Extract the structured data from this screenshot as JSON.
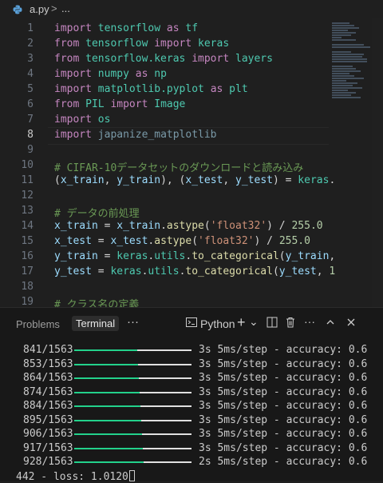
{
  "breadcrumb": {
    "file": "a.py",
    "separator": ">",
    "more": "..."
  },
  "editor": {
    "lines": [
      {
        "n": "1",
        "tokens": [
          {
            "t": "import ",
            "c": "kw"
          },
          {
            "t": "tensorflow ",
            "c": "cls"
          },
          {
            "t": "as ",
            "c": "kw"
          },
          {
            "t": "tf",
            "c": "cls"
          }
        ]
      },
      {
        "n": "2",
        "tokens": [
          {
            "t": "from ",
            "c": "kw"
          },
          {
            "t": "tensorflow ",
            "c": "cls"
          },
          {
            "t": "import ",
            "c": "kw"
          },
          {
            "t": "keras",
            "c": "cls"
          }
        ]
      },
      {
        "n": "3",
        "tokens": [
          {
            "t": "from ",
            "c": "kw"
          },
          {
            "t": "tensorflow.keras ",
            "c": "cls"
          },
          {
            "t": "import ",
            "c": "kw"
          },
          {
            "t": "layers",
            "c": "cls"
          }
        ]
      },
      {
        "n": "4",
        "tokens": [
          {
            "t": "import ",
            "c": "kw"
          },
          {
            "t": "numpy ",
            "c": "cls"
          },
          {
            "t": "as ",
            "c": "kw"
          },
          {
            "t": "np",
            "c": "cls"
          }
        ]
      },
      {
        "n": "5",
        "tokens": [
          {
            "t": "import ",
            "c": "kw"
          },
          {
            "t": "matplotlib.pyplot ",
            "c": "cls"
          },
          {
            "t": "as ",
            "c": "kw"
          },
          {
            "t": "plt",
            "c": "cls"
          }
        ]
      },
      {
        "n": "6",
        "tokens": [
          {
            "t": "from ",
            "c": "kw"
          },
          {
            "t": "PIL ",
            "c": "cls"
          },
          {
            "t": "import ",
            "c": "kw"
          },
          {
            "t": "Image",
            "c": "cls"
          }
        ]
      },
      {
        "n": "7",
        "tokens": [
          {
            "t": "import ",
            "c": "kw"
          },
          {
            "t": "os",
            "c": "cls"
          }
        ]
      },
      {
        "n": "8",
        "active": true,
        "tokens": [
          {
            "t": "import ",
            "c": "kw"
          },
          {
            "t": "japanize_matplotlib",
            "c": "dim"
          }
        ]
      },
      {
        "n": "9",
        "tokens": []
      },
      {
        "n": "10",
        "tokens": [
          {
            "t": "# CIFAR-10データセットのダウンロードと読み込み",
            "c": "cmt"
          }
        ]
      },
      {
        "n": "11",
        "tokens": [
          {
            "t": "(",
            "c": "plain"
          },
          {
            "t": "x_train",
            "c": "id"
          },
          {
            "t": ", ",
            "c": "plain"
          },
          {
            "t": "y_train",
            "c": "id"
          },
          {
            "t": "), (",
            "c": "plain"
          },
          {
            "t": "x_test",
            "c": "id"
          },
          {
            "t": ", ",
            "c": "plain"
          },
          {
            "t": "y_test",
            "c": "id"
          },
          {
            "t": ") = ",
            "c": "plain"
          },
          {
            "t": "keras",
            "c": "cls"
          },
          {
            "t": ".",
            "c": "plain"
          }
        ]
      },
      {
        "n": "12",
        "tokens": []
      },
      {
        "n": "13",
        "tokens": [
          {
            "t": "# データの前処理",
            "c": "cmt"
          }
        ]
      },
      {
        "n": "14",
        "tokens": [
          {
            "t": "x_train",
            "c": "id"
          },
          {
            "t": " = ",
            "c": "plain"
          },
          {
            "t": "x_train",
            "c": "id"
          },
          {
            "t": ".",
            "c": "plain"
          },
          {
            "t": "astype",
            "c": "fn"
          },
          {
            "t": "(",
            "c": "plain"
          },
          {
            "t": "'float32'",
            "c": "str"
          },
          {
            "t": ") / ",
            "c": "plain"
          },
          {
            "t": "255.0",
            "c": "num"
          }
        ]
      },
      {
        "n": "15",
        "tokens": [
          {
            "t": "x_test",
            "c": "id"
          },
          {
            "t": " = ",
            "c": "plain"
          },
          {
            "t": "x_test",
            "c": "id"
          },
          {
            "t": ".",
            "c": "plain"
          },
          {
            "t": "astype",
            "c": "fn"
          },
          {
            "t": "(",
            "c": "plain"
          },
          {
            "t": "'float32'",
            "c": "str"
          },
          {
            "t": ") / ",
            "c": "plain"
          },
          {
            "t": "255.0",
            "c": "num"
          }
        ]
      },
      {
        "n": "16",
        "tokens": [
          {
            "t": "y_train",
            "c": "id"
          },
          {
            "t": " = ",
            "c": "plain"
          },
          {
            "t": "keras",
            "c": "cls"
          },
          {
            "t": ".",
            "c": "plain"
          },
          {
            "t": "utils",
            "c": "cls"
          },
          {
            "t": ".",
            "c": "plain"
          },
          {
            "t": "to_categorical",
            "c": "fn"
          },
          {
            "t": "(",
            "c": "plain"
          },
          {
            "t": "y_train",
            "c": "id"
          },
          {
            "t": ",",
            "c": "plain"
          }
        ]
      },
      {
        "n": "17",
        "tokens": [
          {
            "t": "y_test",
            "c": "id"
          },
          {
            "t": " = ",
            "c": "plain"
          },
          {
            "t": "keras",
            "c": "cls"
          },
          {
            "t": ".",
            "c": "plain"
          },
          {
            "t": "utils",
            "c": "cls"
          },
          {
            "t": ".",
            "c": "plain"
          },
          {
            "t": "to_categorical",
            "c": "fn"
          },
          {
            "t": "(",
            "c": "plain"
          },
          {
            "t": "y_test",
            "c": "id"
          },
          {
            "t": ", ",
            "c": "plain"
          },
          {
            "t": "1",
            "c": "num"
          }
        ]
      },
      {
        "n": "18",
        "tokens": []
      },
      {
        "n": "19",
        "tokens": [
          {
            "t": "# クラス名の定義",
            "c": "cmt"
          }
        ]
      }
    ]
  },
  "panel": {
    "tabs": [
      "Problems",
      "Terminal"
    ],
    "active_tab": "Terminal",
    "more_label": "···",
    "shell_label": "Python",
    "controls": [
      "+",
      "⌄",
      "◫",
      "🗑",
      "···",
      "^",
      "×"
    ]
  },
  "terminal": {
    "accent_color": "#23d18b",
    "progress_lines": [
      {
        "step": "841/1563",
        "progress": 0.538,
        "rest": "3s 5ms/step - accuracy: 0.6"
      },
      {
        "step": "853/1563",
        "progress": 0.546,
        "rest": "3s 5ms/step - accuracy: 0.6"
      },
      {
        "step": "864/1563",
        "progress": 0.553,
        "rest": "3s 5ms/step - accuracy: 0.6"
      },
      {
        "step": "874/1563",
        "progress": 0.559,
        "rest": "3s 5ms/step - accuracy: 0.6"
      },
      {
        "step": "884/1563",
        "progress": 0.566,
        "rest": "3s 5ms/step - accuracy: 0.6"
      },
      {
        "step": "895/1563",
        "progress": 0.573,
        "rest": "3s 5ms/step - accuracy: 0.6"
      },
      {
        "step": "906/1563",
        "progress": 0.58,
        "rest": "3s 5ms/step - accuracy: 0.6"
      },
      {
        "step": "917/1563",
        "progress": 0.587,
        "rest": "3s 5ms/step - accuracy: 0.6"
      },
      {
        "step": "928/1563",
        "progress": 0.594,
        "rest": "2s 5ms/step - accuracy: 0.6"
      }
    ],
    "last_line": "442 - loss: 1.0120"
  }
}
